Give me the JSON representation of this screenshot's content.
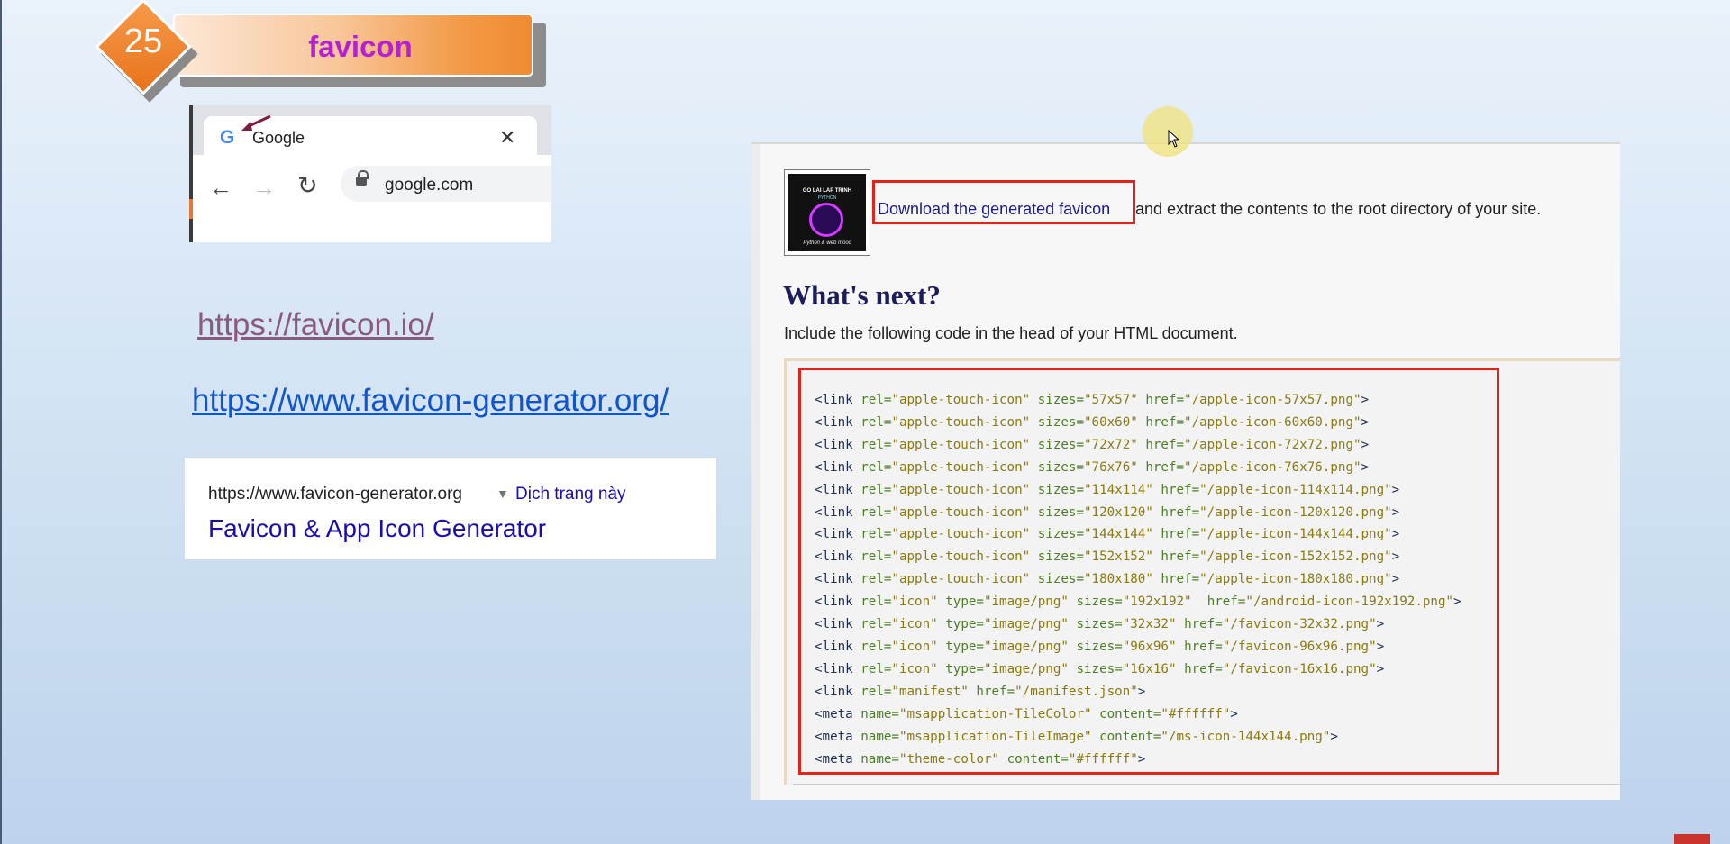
{
  "slide": {
    "number": "25",
    "title": "favicon"
  },
  "browser_mock": {
    "tab_title": "Google",
    "tab_icon": "google-g-icon",
    "address": "google.com"
  },
  "links": {
    "favicon_io": "https://favicon.io/",
    "favicon_generator": "https://www.favicon-generator.org/"
  },
  "search_result": {
    "url": "https://www.favicon-generator.org",
    "translate": "Dịch trang này",
    "title": "Favicon & App Icon Generator"
  },
  "panel": {
    "thumbnail": {
      "line1": "GO LAI LAP TRINH",
      "line2": "PYTHON",
      "line3": "Python & web mooc"
    },
    "download_link": "Download the generated favicon",
    "download_rest": "and extract the contents to the root directory of your site.",
    "heading": "What's next?",
    "instruction": "Include the following code in the head of your HTML document.",
    "code_lines": [
      {
        "tag": "<link",
        "attrs": [
          [
            "rel=",
            "\"apple-touch-icon\""
          ],
          [
            "sizes=",
            "\"57x57\""
          ],
          [
            "href=",
            "\"/apple-icon-57x57.png\""
          ]
        ],
        "end": ">"
      },
      {
        "tag": "<link",
        "attrs": [
          [
            "rel=",
            "\"apple-touch-icon\""
          ],
          [
            "sizes=",
            "\"60x60\""
          ],
          [
            "href=",
            "\"/apple-icon-60x60.png\""
          ]
        ],
        "end": ">"
      },
      {
        "tag": "<link",
        "attrs": [
          [
            "rel=",
            "\"apple-touch-icon\""
          ],
          [
            "sizes=",
            "\"72x72\""
          ],
          [
            "href=",
            "\"/apple-icon-72x72.png\""
          ]
        ],
        "end": ">"
      },
      {
        "tag": "<link",
        "attrs": [
          [
            "rel=",
            "\"apple-touch-icon\""
          ],
          [
            "sizes=",
            "\"76x76\""
          ],
          [
            "href=",
            "\"/apple-icon-76x76.png\""
          ]
        ],
        "end": ">"
      },
      {
        "tag": "<link",
        "attrs": [
          [
            "rel=",
            "\"apple-touch-icon\""
          ],
          [
            "sizes=",
            "\"114x114\""
          ],
          [
            "href=",
            "\"/apple-icon-114x114.png\""
          ]
        ],
        "end": ">"
      },
      {
        "tag": "<link",
        "attrs": [
          [
            "rel=",
            "\"apple-touch-icon\""
          ],
          [
            "sizes=",
            "\"120x120\""
          ],
          [
            "href=",
            "\"/apple-icon-120x120.png\""
          ]
        ],
        "end": ">"
      },
      {
        "tag": "<link",
        "attrs": [
          [
            "rel=",
            "\"apple-touch-icon\""
          ],
          [
            "sizes=",
            "\"144x144\""
          ],
          [
            "href=",
            "\"/apple-icon-144x144.png\""
          ]
        ],
        "end": ">"
      },
      {
        "tag": "<link",
        "attrs": [
          [
            "rel=",
            "\"apple-touch-icon\""
          ],
          [
            "sizes=",
            "\"152x152\""
          ],
          [
            "href=",
            "\"/apple-icon-152x152.png\""
          ]
        ],
        "end": ">"
      },
      {
        "tag": "<link",
        "attrs": [
          [
            "rel=",
            "\"apple-touch-icon\""
          ],
          [
            "sizes=",
            "\"180x180\""
          ],
          [
            "href=",
            "\"/apple-icon-180x180.png\""
          ]
        ],
        "end": ">"
      },
      {
        "tag": "<link",
        "attrs": [
          [
            "rel=",
            "\"icon\""
          ],
          [
            "type=",
            "\"image/png\""
          ],
          [
            "sizes=",
            "\"192x192\" "
          ],
          [
            "href=",
            "\"/android-icon-192x192.png\""
          ]
        ],
        "end": ">"
      },
      {
        "tag": "<link",
        "attrs": [
          [
            "rel=",
            "\"icon\""
          ],
          [
            "type=",
            "\"image/png\""
          ],
          [
            "sizes=",
            "\"32x32\""
          ],
          [
            "href=",
            "\"/favicon-32x32.png\""
          ]
        ],
        "end": ">"
      },
      {
        "tag": "<link",
        "attrs": [
          [
            "rel=",
            "\"icon\""
          ],
          [
            "type=",
            "\"image/png\""
          ],
          [
            "sizes=",
            "\"96x96\""
          ],
          [
            "href=",
            "\"/favicon-96x96.png\""
          ]
        ],
        "end": ">"
      },
      {
        "tag": "<link",
        "attrs": [
          [
            "rel=",
            "\"icon\""
          ],
          [
            "type=",
            "\"image/png\""
          ],
          [
            "sizes=",
            "\"16x16\""
          ],
          [
            "href=",
            "\"/favicon-16x16.png\""
          ]
        ],
        "end": ">"
      },
      {
        "tag": "<link",
        "attrs": [
          [
            "rel=",
            "\"manifest\""
          ],
          [
            "href=",
            "\"/manifest.json\""
          ]
        ],
        "end": ">"
      },
      {
        "tag": "<meta",
        "attrs": [
          [
            "name=",
            "\"msapplication-TileColor\""
          ],
          [
            "content=",
            "\"#ffffff\""
          ]
        ],
        "end": ">"
      },
      {
        "tag": "<meta",
        "attrs": [
          [
            "name=",
            "\"msapplication-TileImage\""
          ],
          [
            "content=",
            "\"/ms-icon-144x144.png\""
          ]
        ],
        "end": ">"
      },
      {
        "tag": "<meta",
        "attrs": [
          [
            "name=",
            "\"theme-color\""
          ],
          [
            "content=",
            "\"#ffffff\""
          ]
        ],
        "end": ">"
      }
    ]
  },
  "colors": {
    "title_text": "#b520d4",
    "badge": "#ef8a30",
    "highlight_box": "#e0241b",
    "link_visited": "#8b5a7a",
    "link": "#1155cc"
  }
}
